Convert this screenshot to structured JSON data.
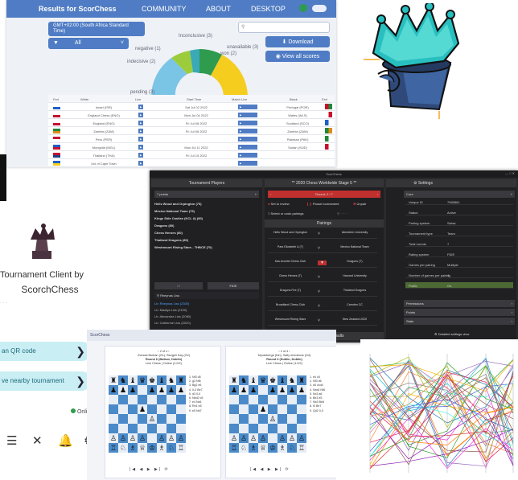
{
  "web": {
    "brand": "Results for ScorChess",
    "nav": [
      "COMMUNITY",
      "ABOUT",
      "DESKTOP"
    ],
    "timezone": "GMT+02:00 (South Africa Standard Time)",
    "filter": "All",
    "download_label": "Download",
    "viewall_label": "View all scores",
    "donut_labels": [
      "negative (1)",
      "Inconclusive (3)",
      "indecisive (2)",
      "pending (3)",
      "won (2)",
      "unavailable (3)"
    ],
    "table_headers": [
      "Fed",
      "White",
      "Live",
      "Start Time",
      "Match Live",
      "Black",
      "Fed"
    ],
    "rows": [
      {
        "white": "Israel (ISR)",
        "time": "Sat Jul 02 2022",
        "black": "Portugal (POR)"
      },
      {
        "white": "England Chess (ENG)",
        "time": "Mon Jul 04 2022",
        "black": "Wales (WLS)"
      },
      {
        "white": "England (ENG)",
        "time": "Fri Jul 08 2022",
        "black": "Scotland (SCO)"
      },
      {
        "white": "Zambia (ZAM)",
        "time": "Fri Jul 08 2022",
        "black": "Zambia (ZAM)"
      },
      {
        "white": "Peru (PER)",
        "time": "",
        "black": "Pakistan (PAK)"
      },
      {
        "white": "Mongolia (MGL)",
        "time": "Mon Jul 11 2022",
        "black": "Sudan (SUD)"
      },
      {
        "white": "Thailand (THA)",
        "time": "Fri Jul 15 2022",
        "black": ""
      },
      {
        "white": "Uni of Cape Town",
        "time": "",
        "black": ""
      }
    ]
  },
  "client": {
    "title_line1": "Tournament Client by",
    "title_line2": "ScorchChess",
    "qr_label": "an QR code",
    "nearby_label": "ve nearby tournament",
    "online_label": "Online"
  },
  "desk": {
    "window_title": "ScorChess",
    "players_header": "Tournament Players",
    "points_filter": "7 points",
    "teams": [
      "Hells Wood and Orpington (75)",
      "Mexico National Team (75)",
      "Kings Side Castles (KCL A) (80)",
      "Dragons (80)",
      "Chess Heroes (80)",
      "Thailand Dragons (80)",
      "Westmount Rising Stars - THBCE (70)"
    ],
    "search_placeholder": "Rheynas Liss",
    "search_results": [
      "Lb: Rheynas Liss (2300)",
      "Lb: Madiya Liss (2100)",
      "Lb: Alexandra Liss (2080)",
      "Lb: Catherine Liss (2020)"
    ],
    "edit_label": "Edit",
    "smart_import": "Smart Import",
    "event_title": "2020 Chess Worldwide Stage 5",
    "round_label": "Round: 2 / 7",
    "action_labels": [
      "Set to review",
      "Pause tournament",
      "Unpair",
      "Select or undo pairings"
    ],
    "pairings_header": "Pairings",
    "pairings": [
      {
        "white": "Hells Wood and Orpington",
        "black": "Aberdeen University"
      },
      {
        "white": "Pars Elizabeth & (T)",
        "black": "Mexico National Team"
      },
      {
        "white": "Kas Avontel Chess Club",
        "black": "Dragons (T)"
      },
      {
        "white": "Chess Heroes (T)",
        "black": "Harvard University"
      },
      {
        "white": "Dragons Fire (T)",
        "black": "Thailand Dragons"
      },
      {
        "white": "Broadland Chess Club",
        "black": "Camden CC"
      },
      {
        "white": "Westmount Rising Stars",
        "black": "New Zealand 2020"
      }
    ],
    "awaiting": "Awaiting 46 results",
    "settings_header": "Settings",
    "section_core": "Core",
    "props": [
      {
        "k": "Unique ID",
        "v": "7065861"
      },
      {
        "k": "Status",
        "v": "Active"
      },
      {
        "k": "Pairing system",
        "v": "Swiss"
      },
      {
        "k": "Tournament type",
        "v": "Team"
      },
      {
        "k": "Total rounds",
        "v": "7"
      },
      {
        "k": "Rating system",
        "v": "FIDE"
      },
      {
        "k": "Games per pairing",
        "v": "Multiple"
      },
      {
        "k": "Number of games per pairing",
        "v": "4"
      },
      {
        "k": "Public",
        "v": "On"
      }
    ],
    "sections": [
      "Permissions",
      "Points",
      "Stats"
    ],
    "detailed_view": "Detailed settings view"
  },
  "boards": {
    "header": "ScorChess",
    "cards": [
      {
        "line1": "Zvezda Burkan (G1), Bezgeil Kay (G2)",
        "line2": "Round 6 (Bulkan, Dublin)",
        "line3": "Live Chess | Online (1:0/2)",
        "moves": [
          "1. Nf3 d5",
          "2. g3 Nf6",
          "3. Bg2 e6",
          "4. 0-0 Be7",
          "5. d3 0-0",
          "6. Nbd2 c5",
          "7. e4 Nc6",
          "8. Re1 b5",
          "9. e5 Nd7"
        ]
      },
      {
        "line1": "Myotoberga (Kin), Sally enedercis (G4)",
        "line2": "Round 6 (Dublin, Dublin)",
        "line3": "Live Chess | Online (1:0/2)",
        "moves": [
          "1. e4 c5",
          "2. Nf3 d6",
          "3. d4 cxd4",
          "4. Nxd4 Nf6",
          "5. Nc3 a6",
          "6. Be3 e5",
          "7. Nb3 Be6",
          "8. f3 Be7",
          "9. Qd2 0-0"
        ]
      }
    ]
  }
}
